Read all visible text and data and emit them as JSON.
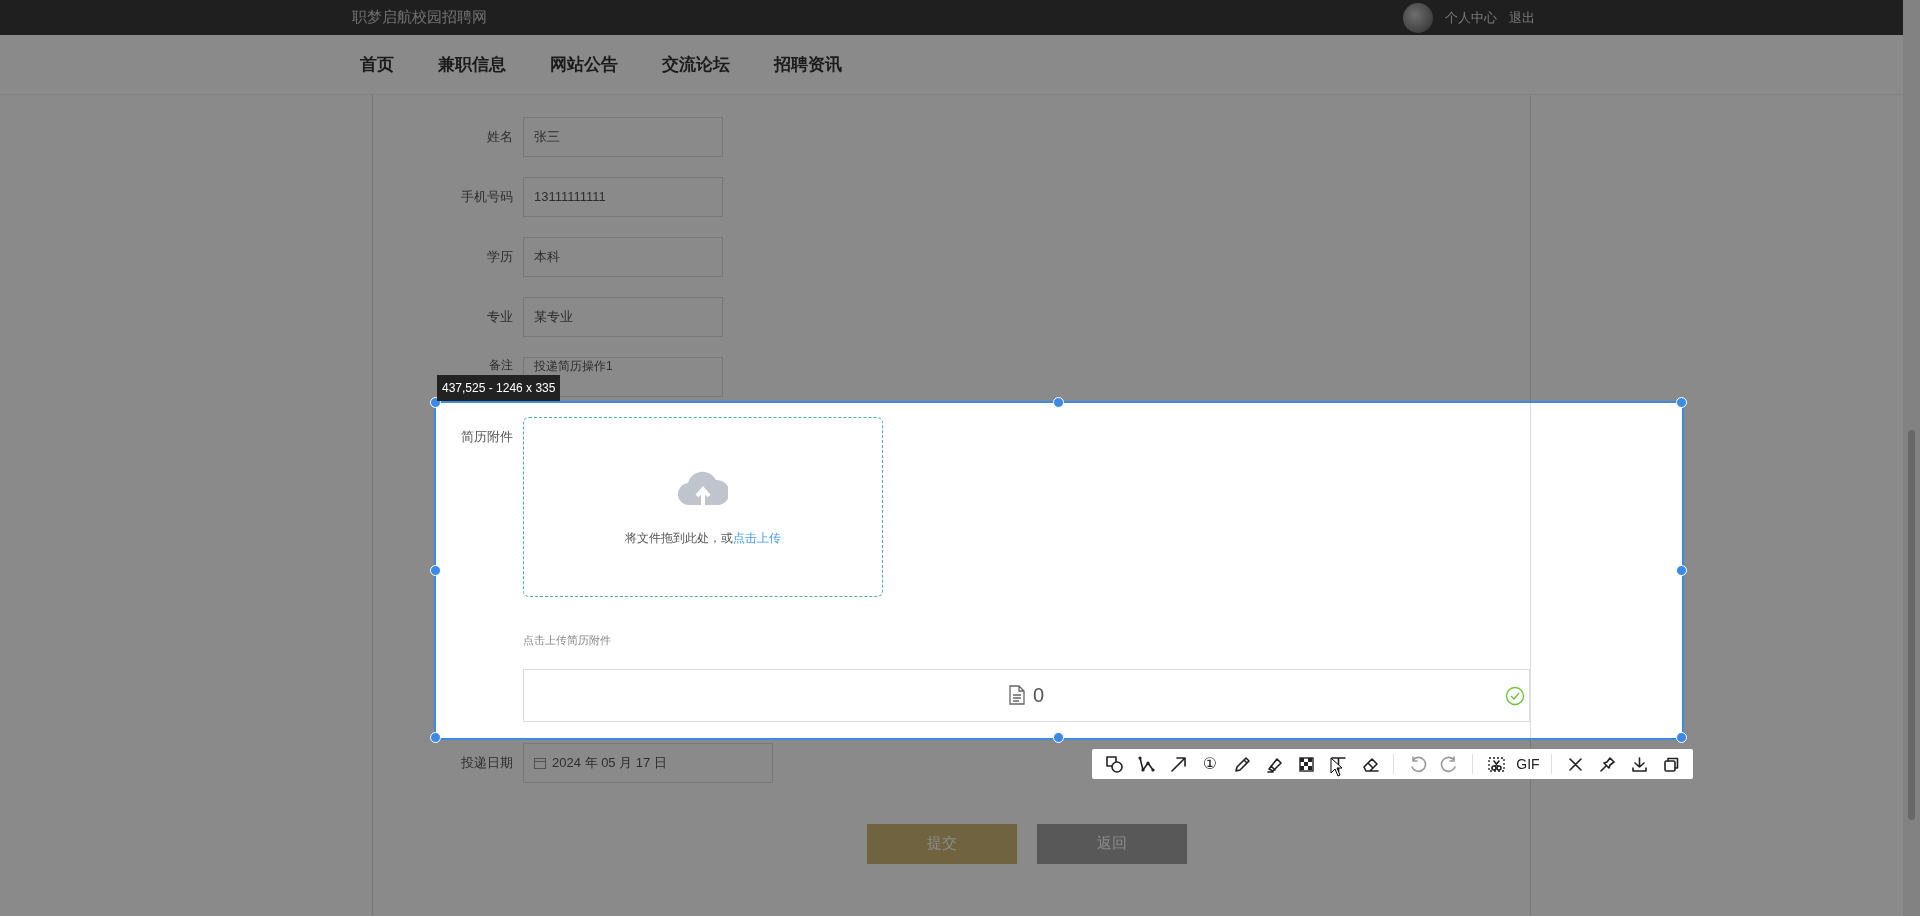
{
  "site_title": "职梦启航校园招聘网",
  "user_menu": [
    {
      "label": "个人中心"
    },
    {
      "label": "退出"
    }
  ],
  "nav": [
    {
      "label": "首页"
    },
    {
      "label": "兼职信息"
    },
    {
      "label": "网站公告"
    },
    {
      "label": "交流论坛"
    },
    {
      "label": "招聘资讯"
    }
  ],
  "form": {
    "fields": [
      {
        "label": "姓名",
        "value": "张三"
      },
      {
        "label": "手机号码",
        "value": "13111111111"
      },
      {
        "label": "学历",
        "value": "本科"
      },
      {
        "label": "专业",
        "value": "某专业"
      },
      {
        "label": "备注",
        "value": "投递简历操作1"
      }
    ],
    "attachment": {
      "label": "简历附件",
      "drop_text": "将文件拖到此处，或",
      "upload_link": "点击上传",
      "hint": "点击上传简历附件",
      "file_name": "0",
      "uploaded": true
    },
    "date": {
      "label": "投递日期",
      "value": "2024 年 05 月 17 日"
    },
    "buttons": [
      {
        "label": "提交",
        "kind": "primary"
      },
      {
        "label": "返回",
        "kind": "secondary"
      }
    ]
  },
  "capture": {
    "size_label": "437,525 - 1246 x 335",
    "tools": [
      {
        "kind": "shape"
      },
      {
        "kind": "polyline"
      },
      {
        "kind": "arrow"
      },
      {
        "kind": "number",
        "label": "①"
      },
      {
        "kind": "pencil"
      },
      {
        "kind": "marker"
      },
      {
        "kind": "mosaic"
      },
      {
        "kind": "text"
      },
      {
        "kind": "eraser"
      },
      {
        "kind": "separator"
      },
      {
        "kind": "undo"
      },
      {
        "kind": "redo"
      },
      {
        "kind": "separator"
      },
      {
        "kind": "scissors"
      },
      {
        "kind": "label",
        "label": "GIF"
      },
      {
        "kind": "separator"
      },
      {
        "kind": "close"
      },
      {
        "kind": "pin"
      },
      {
        "kind": "download"
      },
      {
        "kind": "copy"
      }
    ]
  }
}
